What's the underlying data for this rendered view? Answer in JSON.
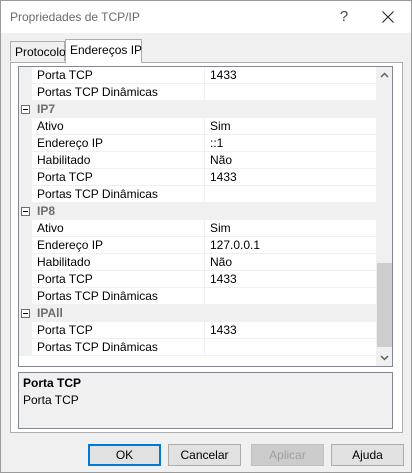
{
  "window": {
    "title": "Propriedades de TCP/IP",
    "help_glyph": "?"
  },
  "tabs": [
    {
      "label": "Protocolo",
      "active": false
    },
    {
      "label": "Endereços IP",
      "active": true
    }
  ],
  "grid": {
    "rows": [
      {
        "type": "prop",
        "name": "Porta TCP",
        "value": "1433"
      },
      {
        "type": "prop",
        "name": "Portas TCP Dinâmicas",
        "value": ""
      },
      {
        "type": "cat",
        "name": "IP7"
      },
      {
        "type": "prop",
        "name": "Ativo",
        "value": "Sim"
      },
      {
        "type": "prop",
        "name": "Endereço IP",
        "value": "::1"
      },
      {
        "type": "prop",
        "name": "Habilitado",
        "value": "Não"
      },
      {
        "type": "prop",
        "name": "Porta TCP",
        "value": "1433"
      },
      {
        "type": "prop",
        "name": "Portas TCP Dinâmicas",
        "value": ""
      },
      {
        "type": "cat",
        "name": "IP8"
      },
      {
        "type": "prop",
        "name": "Ativo",
        "value": "Sim"
      },
      {
        "type": "prop",
        "name": "Endereço IP",
        "value": "127.0.0.1"
      },
      {
        "type": "prop",
        "name": "Habilitado",
        "value": "Não"
      },
      {
        "type": "prop",
        "name": "Porta TCP",
        "value": "1433"
      },
      {
        "type": "prop",
        "name": "Portas TCP Dinâmicas",
        "value": ""
      },
      {
        "type": "cat",
        "name": "IPAll"
      },
      {
        "type": "prop",
        "name": "Porta TCP",
        "value": "1433"
      },
      {
        "type": "prop",
        "name": "Portas TCP Dinâmicas",
        "value": ""
      }
    ]
  },
  "description": {
    "title": "Porta TCP",
    "text": "Porta TCP"
  },
  "buttons": {
    "ok": "OK",
    "cancel": "Cancelar",
    "apply": "Aplicar",
    "help": "Ajuda"
  },
  "colors": {
    "accent": "#0078d7",
    "category_text": "#6d6d6d"
  }
}
